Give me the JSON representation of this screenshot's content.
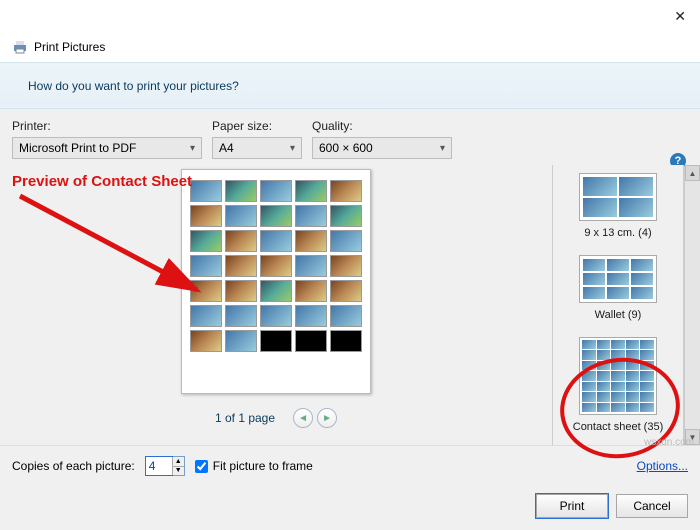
{
  "titlebar": {
    "close_tooltip": "Close"
  },
  "header": {
    "app_title": "Print Pictures"
  },
  "banner": {
    "question": "How do you want to print your pictures?"
  },
  "controls": {
    "printer_label": "Printer:",
    "printer_value": "Microsoft Print to PDF",
    "paper_label": "Paper size:",
    "paper_value": "A4",
    "quality_label": "Quality:",
    "quality_value": "600 × 600"
  },
  "annotation": {
    "text": "Preview of Contact Sheet"
  },
  "preview": {
    "page_indicator": "1 of 1 page"
  },
  "layouts": {
    "items": [
      {
        "label": "9 x 13 cm. (4)"
      },
      {
        "label": "Wallet (9)"
      },
      {
        "label": "Contact sheet (35)"
      }
    ]
  },
  "bottom": {
    "copies_label": "Copies of each picture:",
    "copies_value": "4",
    "fit_label": "Fit picture to frame",
    "options_link": "Options..."
  },
  "buttons": {
    "print": "Print",
    "cancel": "Cancel"
  },
  "watermark": "wsxdn.com"
}
